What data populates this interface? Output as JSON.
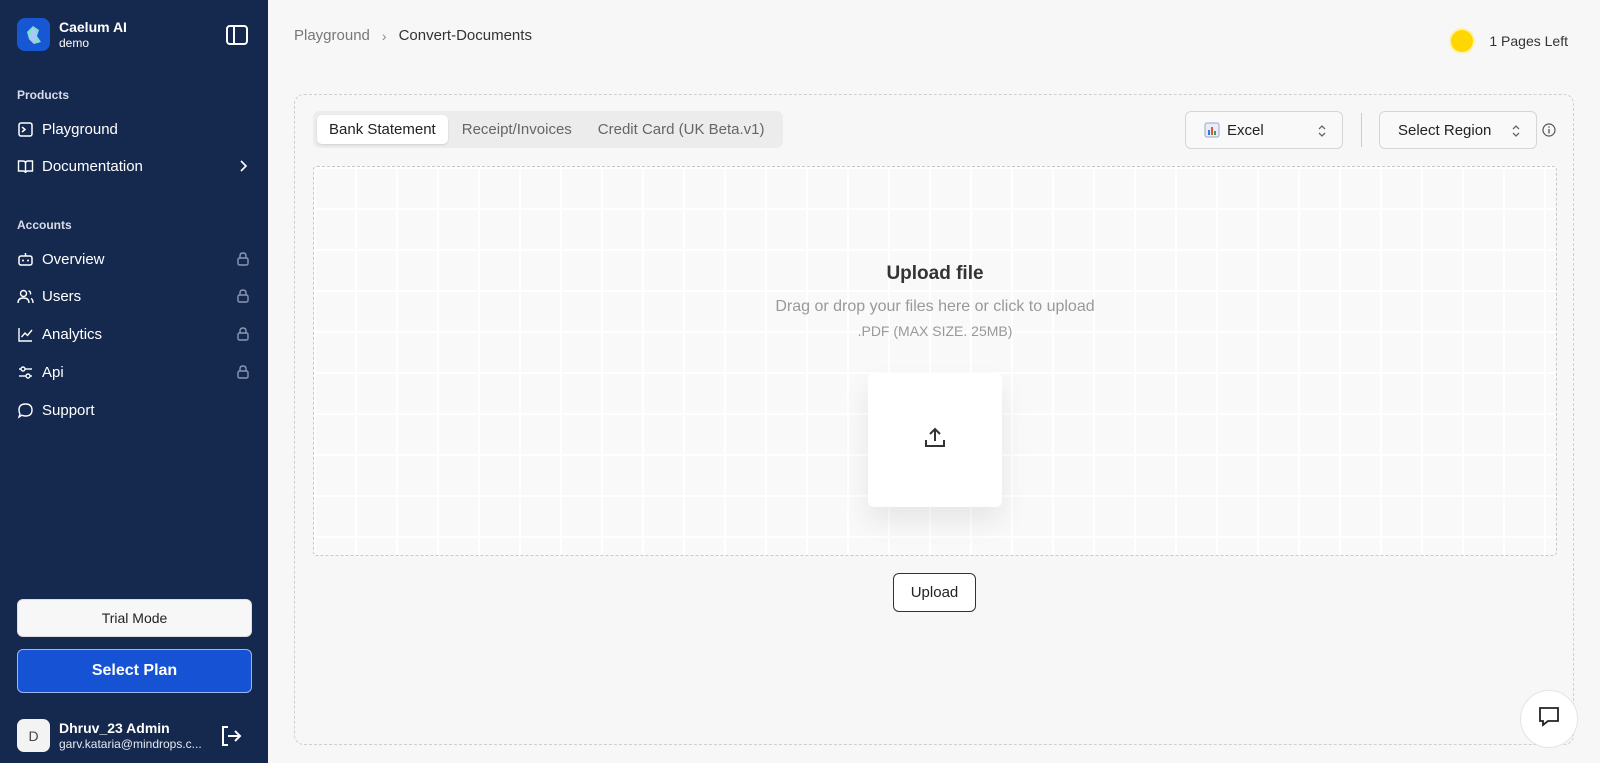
{
  "sidebar": {
    "brand_name": "Caelum AI",
    "brand_sub": "demo",
    "section_products": "Products",
    "section_accounts": "Accounts",
    "items": [
      {
        "label": "Playground",
        "icon": "playground-icon",
        "trail": "none"
      },
      {
        "label": "Documentation",
        "icon": "book-icon",
        "trail": "chevron-right-icon"
      },
      {
        "label": "Overview",
        "icon": "bot-icon",
        "trail": "lock-icon"
      },
      {
        "label": "Users",
        "icon": "users-icon",
        "trail": "lock-icon"
      },
      {
        "label": "Analytics",
        "icon": "chart-line-icon",
        "trail": "lock-icon"
      },
      {
        "label": "Api",
        "icon": "settings-sliders-icon",
        "trail": "lock-icon"
      },
      {
        "label": "Support",
        "icon": "chat-icon",
        "trail": "none"
      }
    ],
    "trial_label": "Trial Mode",
    "plan_label": "Select Plan",
    "user_initial": "D",
    "user_name": "Dhruv_23 Admin",
    "user_email": "garv.kataria@mindrops.c..."
  },
  "header": {
    "breadcrumb_root": "Playground",
    "breadcrumb_current": "Convert-Documents",
    "pages_left": "1 Pages Left"
  },
  "tabs": [
    "Bank Statement",
    "Receipt/Invoices",
    "Credit Card (UK Beta.v1)"
  ],
  "active_tab": 0,
  "format_select": "Excel",
  "region_select": "Select Region",
  "upload": {
    "title": "Upload file",
    "subtitle": "Drag or drop your files here or click to upload",
    "hint": ".PDF (MAX SIZE. 25MB)",
    "button": "Upload"
  },
  "colors": {
    "sidebar_bg": "#15294f",
    "primary": "#1652d4",
    "coin": "#ffd600"
  }
}
